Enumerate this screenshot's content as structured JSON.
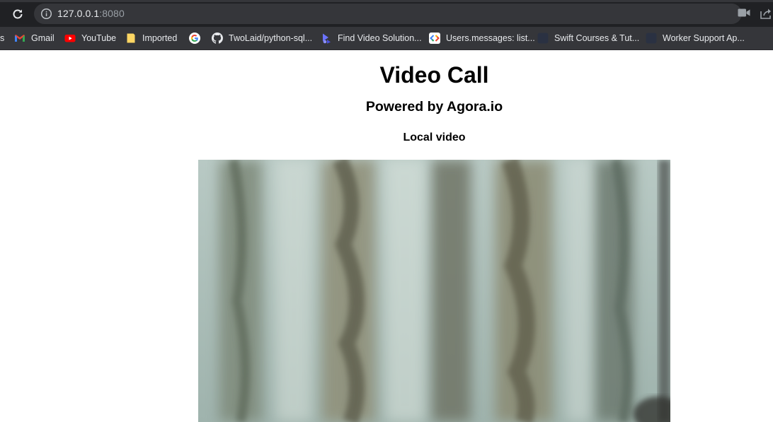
{
  "browser": {
    "url_host": "127.0.0.1",
    "url_port": ":8080",
    "icons": {
      "reload": "reload-icon",
      "site_info": "info-icon",
      "camera": "camera-icon",
      "share": "share-icon"
    }
  },
  "bookmarks": [
    {
      "label": "s",
      "icon": "apps-partial-icon"
    },
    {
      "label": "Gmail",
      "icon": "gmail-icon"
    },
    {
      "label": "YouTube",
      "icon": "youtube-icon"
    },
    {
      "label": "Imported",
      "icon": "folder-icon"
    },
    {
      "label": "",
      "icon": "google-icon"
    },
    {
      "label": "TwoLaid/python-sql...",
      "icon": "github-icon"
    },
    {
      "label": "Find Video Solution...",
      "icon": "video-solution-icon"
    },
    {
      "label": "Users.messages: list...",
      "icon": "google-developers-icon"
    },
    {
      "label": "Swift Courses & Tut...",
      "icon": "site-icon"
    },
    {
      "label": "Worker Support Ap...",
      "icon": "site-icon"
    }
  ],
  "page": {
    "title": "Video Call",
    "subtitle": "Powered by Agora.io",
    "local_video_label": "Local video"
  },
  "colors": {
    "chrome_dark": "#202124",
    "chrome_bar": "#35363a",
    "page_bg": "#ffffff",
    "text": "#000000"
  }
}
